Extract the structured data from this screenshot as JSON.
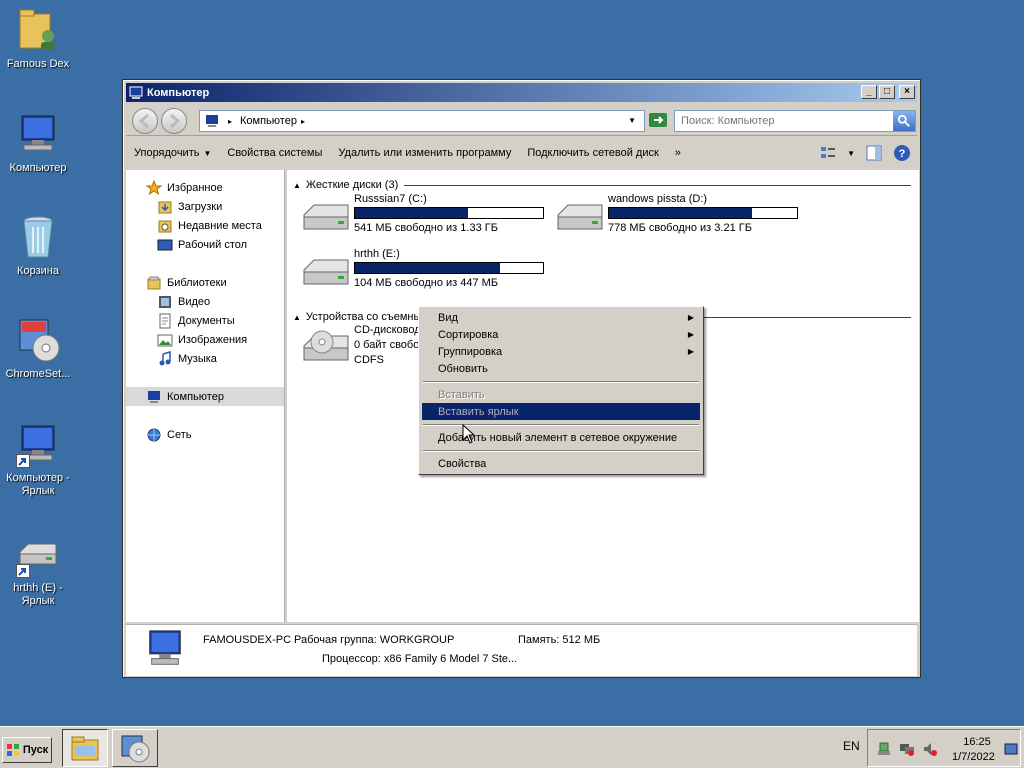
{
  "desktop": {
    "icons": [
      {
        "label": "Famous Dex"
      },
      {
        "label": "Компьютер"
      },
      {
        "label": "Корзина"
      },
      {
        "label": "ChromeSet..."
      },
      {
        "label_line1": "Компьютер -",
        "label_line2": "Ярлык"
      },
      {
        "label_line1": "hrthh (E) -",
        "label_line2": "Ярлык"
      }
    ]
  },
  "window": {
    "title": "Компьютер",
    "controls": {
      "minimize": "_",
      "maximize": "□",
      "close": "×"
    }
  },
  "address": {
    "crumb": "Компьютер",
    "search_placeholder": "Поиск: Компьютер"
  },
  "commands": {
    "organize": "Упорядочить",
    "system_props": "Свойства системы",
    "uninstall": "Удалить или изменить программу",
    "map_drive": "Подключить сетевой диск",
    "more": "»"
  },
  "nav": {
    "favorites": "Избранное",
    "downloads": "Загрузки",
    "recent": "Недавние места",
    "desktop": "Рабочий стол",
    "libraries": "Библиотеки",
    "video": "Видео",
    "documents": "Документы",
    "pictures": "Изображения",
    "music": "Музыка",
    "computer": "Компьютер",
    "network": "Сеть"
  },
  "content": {
    "hdd_group": "Жесткие диски (3)",
    "removable_group": "Устройства со съемны",
    "drives": [
      {
        "name": "Russsian7  (C:)",
        "free": "541 МБ свободно из 1.33 ГБ",
        "used_fraction": 0.6
      },
      {
        "name": "wandows pissta (D:)",
        "free": "778 МБ свободно из 3.21 ГБ",
        "used_fraction": 0.76
      },
      {
        "name": "hrthh (E:)",
        "free": "104 МБ свободно из 447 МБ",
        "used_fraction": 0.77
      }
    ],
    "cd": {
      "line1": "CD-дисковод",
      "line2": "0 байт свобо",
      "line3": "CDFS"
    }
  },
  "details": {
    "pc_name": "FAMOUSDEX-PC",
    "workgroup": "Рабочая группа: WORKGROUP",
    "memory": "Память: 512 МБ",
    "cpu": "Процессор: x86 Family 6 Model 7 Ste..."
  },
  "context_menu": {
    "view": "Вид",
    "sort": "Сортировка",
    "group": "Группировка",
    "refresh": "Обновить",
    "paste": "Вставить",
    "paste_shortcut": "Вставить ярлык",
    "add_network": "Добавить новый элемент в сетевое окружение",
    "properties": "Свойства"
  },
  "taskbar": {
    "start": "Пуск",
    "lang": "EN",
    "time": "16:25",
    "date": "1/7/2022"
  },
  "colors": {
    "desktop_bg": "#3a6ea5",
    "highlight": "#0a246a"
  }
}
